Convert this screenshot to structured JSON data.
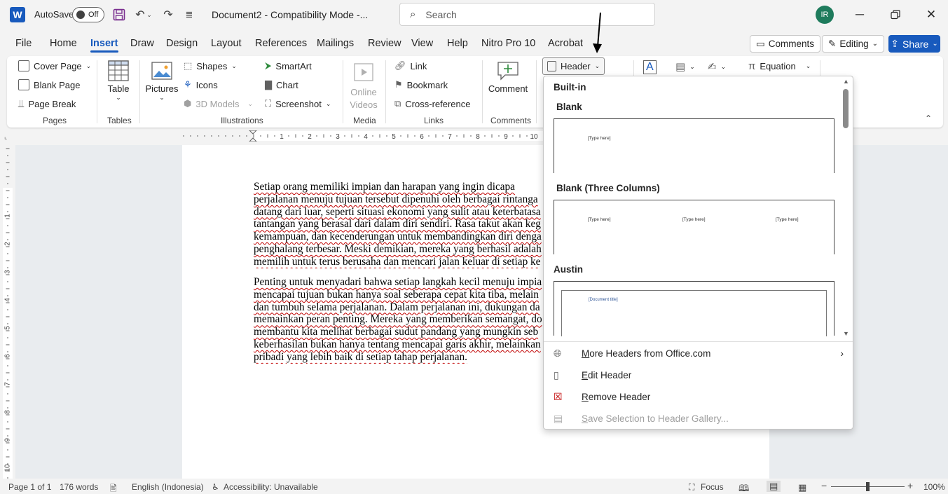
{
  "titlebar": {
    "app_logo": "W",
    "autosave_label": "AutoSave",
    "autosave_state": "Off",
    "doc_title": "Document2 - Compatibility Mode -...",
    "search_placeholder": "Search",
    "avatar_initials": "IR",
    "icons": [
      "save-icon",
      "undo-icon",
      "redo-icon",
      "customize-icon",
      "minimize-icon",
      "restore-icon",
      "close-icon"
    ]
  },
  "menu": {
    "tabs": [
      "File",
      "Home",
      "Insert",
      "Draw",
      "Design",
      "Layout",
      "References",
      "Mailings",
      "Review",
      "View",
      "Help",
      "Nitro Pro 10",
      "Acrobat"
    ],
    "active_tab": "Insert",
    "comments_label": "Comments",
    "editing_label": "Editing",
    "share_label": "Share"
  },
  "ribbon": {
    "pages": {
      "cover_page": "Cover Page",
      "blank_page": "Blank Page",
      "page_break": "Page Break",
      "label": "Pages"
    },
    "tables": {
      "table": "Table",
      "label": "Tables"
    },
    "illustrations": {
      "pictures": "Pictures",
      "shapes": "Shapes",
      "icons": "Icons",
      "models": "3D Models",
      "smartart": "SmartArt",
      "chart": "Chart",
      "screenshot": "Screenshot",
      "label": "Illustrations"
    },
    "media": {
      "online": "Online",
      "videos": "Videos",
      "label": "Media"
    },
    "links": {
      "link": "Link",
      "bookmark": "Bookmark",
      "cross_reference": "Cross-reference",
      "label": "Links"
    },
    "comments": {
      "comment": "Comment",
      "label": "Comments"
    },
    "header_footer": {
      "header": "Header"
    },
    "symbols": {
      "equation": "Equation"
    }
  },
  "document": {
    "para1": [
      "Setiap orang memiliki impian dan harapan yang ingin dicapa",
      "perjalanan menuju tujuan tersebut dipenuhi oleh berbagai rintanga",
      "datang dari luar, seperti situasi ekonomi yang sulit atau keterbatasa",
      "tantangan yang berasal dari dalam diri sendiri. Rasa takut akan keg",
      "kemampuan, dan kecenderungan untuk membandingkan diri denga",
      "penghalang terbesar. Meski demikian, mereka yang berhasil adalah",
      "memilih untuk terus berusaha dan mencari jalan keluar di setiap ke"
    ],
    "para2": [
      "Penting untuk menyadari bahwa setiap langkah kecil menuju impia",
      "mencapai tujuan bukan hanya soal seberapa cepat kita tiba, melain",
      "dan tumbuh selama perjalanan. Dalam perjalanan ini, dukungan da",
      "memainkan peran penting. Mereka yang memberikan semangat, do",
      "membantu kita melihat berbagai sudut pandang yang mungkin seb",
      "keberhasilan bukan hanya tentang mencapai garis akhir, melainkan",
      "pribadi yang lebih baik di setiap tahap perjalanan."
    ]
  },
  "header_dropdown": {
    "section": "Built-in",
    "gallery": [
      {
        "name": "Blank",
        "placeholders": [
          "[Type here]"
        ]
      },
      {
        "name": "Blank (Three Columns)",
        "placeholders": [
          "[Type here]",
          "[Type here]",
          "[Type here]"
        ]
      },
      {
        "name": "Austin",
        "placeholders": [
          "[Document title]"
        ]
      }
    ],
    "actions": [
      {
        "label": "More Headers from Office.com",
        "icon": "globe-icon",
        "enabled": true
      },
      {
        "label": "Edit Header",
        "icon": "document-icon",
        "enabled": true
      },
      {
        "label": "Remove Header",
        "icon": "remove-header-icon",
        "enabled": true
      },
      {
        "label": "Save Selection to Header Gallery...",
        "icon": "save-selection-icon",
        "enabled": false
      }
    ]
  },
  "ruler": {
    "h_numbers": [
      "1",
      "2",
      "3",
      "4",
      "5",
      "6",
      "7",
      "8",
      "9",
      "10"
    ],
    "v_numbers": [
      "1",
      "2",
      "3",
      "4",
      "5",
      "6",
      "7",
      "8",
      "9",
      "10"
    ]
  },
  "statusbar": {
    "page": "Page 1 of 1",
    "words": "176 words",
    "language": "English (Indonesia)",
    "accessibility": "Accessibility: Unavailable",
    "focus": "Focus",
    "zoom": "100%"
  }
}
